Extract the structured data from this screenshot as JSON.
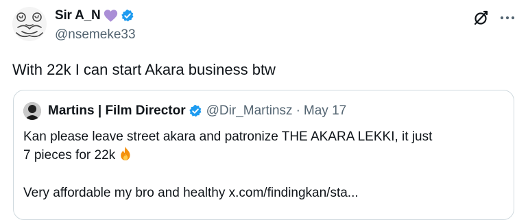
{
  "tweet": {
    "display_name": "Sir A_N",
    "handle": "@nsemeke33",
    "text": "With 22k I can start Akara business btw",
    "icons": {
      "name_emoji": "purple-heart-icon",
      "verified": "verified-badge-icon",
      "grok": "grok-icon",
      "more": "more-icon"
    }
  },
  "quote": {
    "display_name": "Martins | Film Director",
    "handle": "@Dir_Martinsz",
    "separator": "·",
    "date": "May 17",
    "line1": "Kan please leave street akara and patronize THE AKARA LEKKI, it just",
    "line2": "7 pieces for 22k",
    "line2_emoji": "fire-icon",
    "line3": "Very affordable my bro and healthy  x.com/findingkan/sta..."
  },
  "colors": {
    "text": "#0f1419",
    "secondary": "#536471",
    "verified_blue": "#1d9bf0",
    "heart_purple": "#aa8ed6",
    "card_border": "#cfd9de"
  }
}
